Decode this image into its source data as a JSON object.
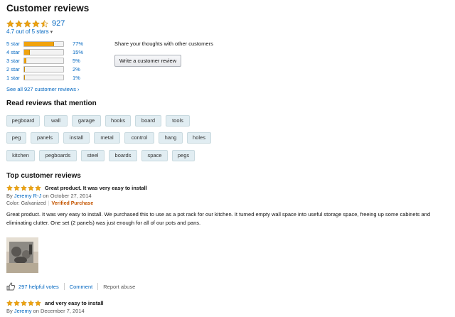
{
  "header": {
    "title": "Customer reviews"
  },
  "rating": {
    "count": "927",
    "out_of": "4.7 out of 5 stars",
    "filled_stars": 4.5
  },
  "histogram": [
    {
      "label": "5 star",
      "pct": "77%",
      "fill": 0.77
    },
    {
      "label": "4 star",
      "pct": "15%",
      "fill": 0.15
    },
    {
      "label": "3 star",
      "pct": "5%",
      "fill": 0.05
    },
    {
      "label": "2 star",
      "pct": "2%",
      "fill": 0.02
    },
    {
      "label": "1 star",
      "pct": "1%",
      "fill": 0.01
    }
  ],
  "share": {
    "text": "Share your thoughts with other customers",
    "button": "Write a customer review"
  },
  "see_all": "See all 927 customer reviews ›",
  "mentions": {
    "title": "Read reviews that mention",
    "tags": [
      "pegboard",
      "wall",
      "garage",
      "hooks",
      "board",
      "tools",
      "peg",
      "panels",
      "install",
      "metal",
      "control",
      "hang",
      "holes",
      "kitchen",
      "pegboards",
      "steel",
      "boards",
      "space",
      "pegs"
    ]
  },
  "top_reviews": {
    "title": "Top customer reviews",
    "review1": {
      "title": "Great product. It was very easy to install",
      "by_prefix": "By",
      "author": "Jeremy R-J",
      "date": "on October 27, 2014",
      "color": "Color: Galvanized",
      "verified": "Verified Purchase",
      "body": "Great product. It was very easy to install. We purchased this to use as a pot rack for our kitchen. It turned empty wall space into useful storage space, freeing up some cabinets and eliminating clutter. One set (2 panels) was just enough for all of our pots and pans.",
      "helpful": "297 helpful votes",
      "comment": "Comment",
      "report": "Report abuse"
    },
    "review2": {
      "title": "and very easy to install",
      "by_prefix": "By",
      "author": "Jeremy",
      "date": "on December 7, 2014"
    }
  },
  "colors": {
    "star": "#f0a30f",
    "link": "#0066c0",
    "tag_bg": "#e1edf2"
  }
}
